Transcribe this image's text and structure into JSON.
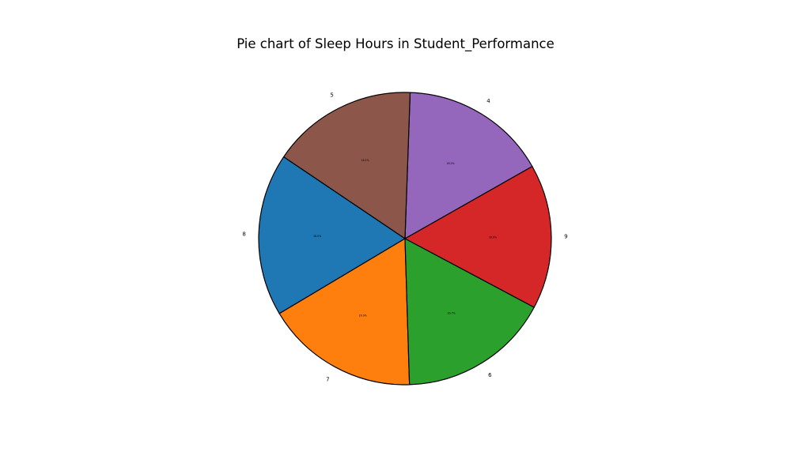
{
  "chart_data": {
    "type": "pie",
    "title": "Pie chart of Sleep Hours in Student_Performance",
    "start_angle_deg": 146,
    "direction": "counterclockwise",
    "slices": [
      {
        "label": "8",
        "value": 18.0,
        "pct_text": "18.0%",
        "color": "#1f77b4"
      },
      {
        "label": "7",
        "value": 16.9,
        "pct_text": "16.9%",
        "color": "#ff7f0e"
      },
      {
        "label": "6",
        "value": 16.7,
        "pct_text": "16.7%",
        "color": "#2ca02c"
      },
      {
        "label": "9",
        "value": 16.0,
        "pct_text": "16.0%",
        "color": "#d62728"
      },
      {
        "label": "4",
        "value": 16.2,
        "pct_text": "16.2%",
        "color": "#9467bd"
      },
      {
        "label": "5",
        "value": 16.1,
        "pct_text": "16.1%",
        "color": "#8c564b"
      }
    ],
    "edge_color": "#000000",
    "legend": "none"
  }
}
